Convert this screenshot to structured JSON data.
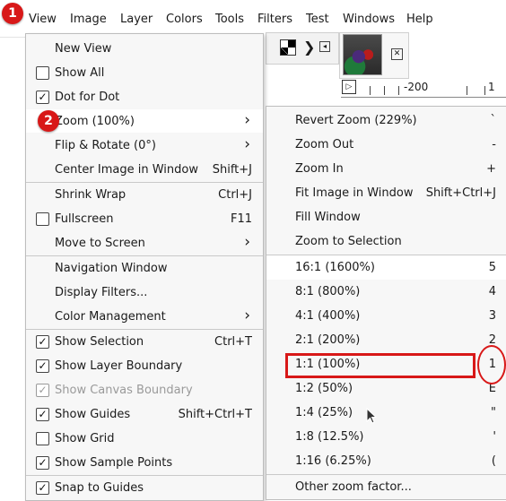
{
  "menubar": {
    "items": [
      "View",
      "Image",
      "Layer",
      "Colors",
      "Tools",
      "Filters",
      "Test",
      "Windows",
      "Help"
    ]
  },
  "badges": {
    "one": "1",
    "two": "2"
  },
  "ruler": {
    "label_a": "-200",
    "label_b": "1"
  },
  "view_menu": {
    "new_view": "New View",
    "show_all": "Show All",
    "dot_for_dot": "Dot for Dot",
    "zoom": "Zoom (100%)",
    "flip_rotate": "Flip & Rotate (0°)",
    "center_image": "Center Image in Window",
    "center_image_shortcut": "Shift+J",
    "shrink_wrap": "Shrink Wrap",
    "shrink_wrap_shortcut": "Ctrl+J",
    "fullscreen": "Fullscreen",
    "fullscreen_shortcut": "F11",
    "move_to_screen": "Move to Screen",
    "navigation_window": "Navigation Window",
    "display_filters": "Display Filters...",
    "color_management": "Color Management",
    "show_selection": "Show Selection",
    "show_selection_shortcut": "Ctrl+T",
    "show_layer_boundary": "Show Layer Boundary",
    "show_canvas_boundary": "Show Canvas Boundary",
    "show_guides": "Show Guides",
    "show_guides_shortcut": "Shift+Ctrl+T",
    "show_grid": "Show Grid",
    "show_sample_points": "Show Sample Points",
    "snap_to_guides": "Snap to Guides"
  },
  "zoom_menu": {
    "revert_zoom": "Revert Zoom (229%)",
    "revert_zoom_key": "`",
    "zoom_out": "Zoom Out",
    "zoom_out_key": "-",
    "zoom_in": "Zoom In",
    "zoom_in_key": "+",
    "fit_image": "Fit Image in Window",
    "fit_image_key": "Shift+Ctrl+J",
    "fill_window": "Fill Window",
    "zoom_selection": "Zoom to Selection",
    "z16": "16:1  (1600%)",
    "z16_key": "5",
    "z8": "8:1  (800%)",
    "z8_key": "4",
    "z4": "4:1  (400%)",
    "z4_key": "3",
    "z2": "2:1  (200%)",
    "z2_key": "2",
    "z1": "1:1  (100%)",
    "z1_key": "1",
    "zhalf": "1:2  (50%)",
    "zhalf_key": "E",
    "zquarter": "1:4  (25%)",
    "zquarter_key": "\"",
    "zeighth": "1:8  (12.5%)",
    "zeighth_key": "'",
    "zsixteenth": "1:16  (6.25%)",
    "zsixteenth_key": "(",
    "other_zoom": "Other zoom factor..."
  },
  "colors": {
    "highlight": "#d81818"
  }
}
